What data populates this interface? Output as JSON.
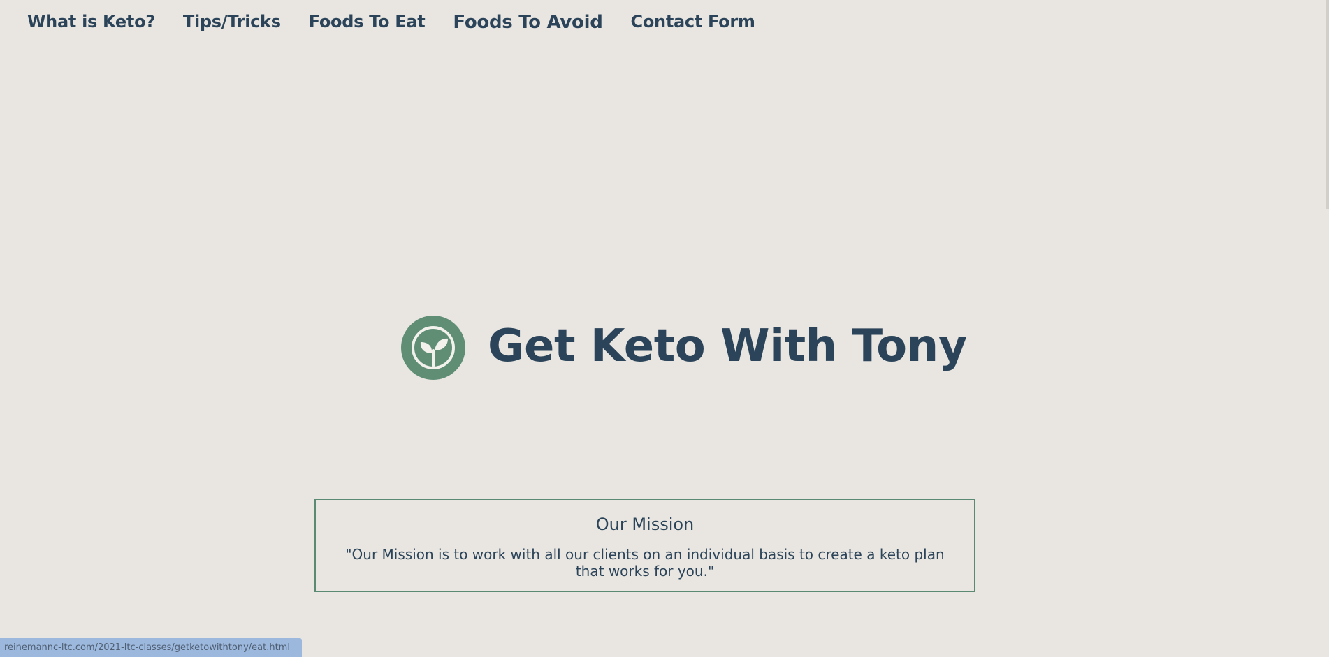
{
  "nav": {
    "items": [
      {
        "label": "What is Keto?"
      },
      {
        "label": "Tips/Tricks"
      },
      {
        "label": "Foods To Eat"
      },
      {
        "label": "Foods To Avoid"
      },
      {
        "label": "Contact Form"
      }
    ]
  },
  "hero": {
    "brand_name": "Get Keto With Tony",
    "logo_icon": "sprout-icon"
  },
  "mission": {
    "title": "Our Mission",
    "text": "\"Our Mission is to work with all our clients on an individual basis to create a keto plan that works for you.\""
  },
  "status_bar": {
    "url": "reinemannc-ltc.com/2021-ltc-classes/getketowithtony/eat.html"
  },
  "colors": {
    "background": "#e9e6e1",
    "text": "#2b4459",
    "accent_green": "#5f8e75",
    "status_bg": "#9cb8dc"
  }
}
